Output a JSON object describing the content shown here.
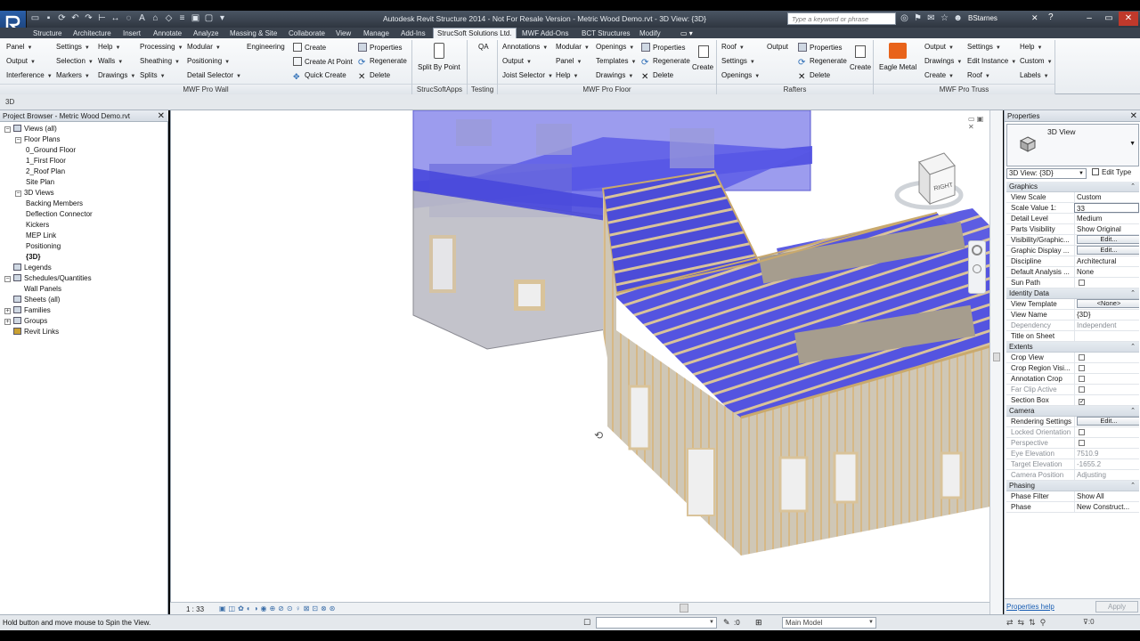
{
  "window": {
    "title": "Autodesk Revit Structure 2014 - Not For Resale Version -    Metric Wood Demo.rvt - 3D View: {3D}",
    "search_placeholder": "Type a keyword or phrase",
    "user": "BStarnes"
  },
  "tabs": [
    "Structure",
    "Architecture",
    "Insert",
    "Annotate",
    "Analyze",
    "Massing & Site",
    "Collaborate",
    "View",
    "Manage",
    "Add-Ins",
    "StrucSoft Solutions Ltd.",
    "MWF Add-Ons",
    "BCT Structures",
    "Modify"
  ],
  "active_tab": "StrucSoft Solutions Ltd.",
  "ribbon": {
    "wall": {
      "col1": [
        "Panel",
        "Output",
        "Interference"
      ],
      "col2": [
        "Settings",
        "Selection",
        "Markers"
      ],
      "col3": [
        "Help",
        "Walls",
        "Drawings"
      ],
      "col4": [
        "Processing",
        "Sheathing",
        "Splits"
      ],
      "col5": [
        "Modular",
        "Positioning",
        "Detail Selector"
      ],
      "engineering": "Engineering",
      "col6": [
        "Create",
        "Create At Point",
        "Quick Create"
      ],
      "col7": [
        "Properties",
        "Regenerate",
        "Delete"
      ],
      "label": "MWF Pro Wall"
    },
    "strucsoftapps": {
      "split": "Split By Point",
      "label": "StrucSoftApps"
    },
    "testing": {
      "qa": "QA",
      "label": "Testing"
    },
    "floor": {
      "col1": [
        "Annotations",
        "Output",
        "Joist Selector"
      ],
      "col2": [
        "Modular",
        "Panel",
        "Help"
      ],
      "col3": [
        "Openings",
        "Templates",
        "Drawings"
      ],
      "col4": [
        "Properties",
        "Regenerate",
        "Delete"
      ],
      "create": "Create",
      "label": "MWF Pro Floor"
    },
    "rafters": {
      "col1": [
        "Roof",
        "Settings",
        "Openings"
      ],
      "output": "Output",
      "col2": [
        "Properties",
        "Regenerate",
        "Delete"
      ],
      "create": "Create",
      "label": "Rafters"
    },
    "truss": {
      "eagle": "Eagle Metal",
      "col1": [
        "Output",
        "Drawings",
        "Create"
      ],
      "col2": [
        "Settings",
        "Edit Instance",
        "Roof"
      ],
      "col3": [
        "Help",
        "Custom",
        "Labels"
      ],
      "label": "MWF Pro Truss"
    }
  },
  "options_bar": {
    "text": "3D"
  },
  "project_browser": {
    "title": "Project Browser - Metric Wood Demo.rvt",
    "items": [
      {
        "label": "Views (all)",
        "level": 0,
        "toggle": "-"
      },
      {
        "label": "Floor Plans",
        "level": 1,
        "toggle": "-"
      },
      {
        "label": "0_Ground Floor",
        "level": 2,
        "toggle": ""
      },
      {
        "label": "1_First Floor",
        "level": 2,
        "toggle": ""
      },
      {
        "label": "2_Roof Plan",
        "level": 2,
        "toggle": ""
      },
      {
        "label": "Site Plan",
        "level": 2,
        "toggle": ""
      },
      {
        "label": "3D Views",
        "level": 1,
        "toggle": "-"
      },
      {
        "label": "Backing Members",
        "level": 2,
        "toggle": ""
      },
      {
        "label": "Deflection Connector",
        "level": 2,
        "toggle": ""
      },
      {
        "label": "Kickers",
        "level": 2,
        "toggle": ""
      },
      {
        "label": "MEP Link",
        "level": 2,
        "toggle": ""
      },
      {
        "label": "Positioning",
        "level": 2,
        "toggle": ""
      },
      {
        "label": "{3D}",
        "level": 2,
        "toggle": "",
        "bold": true
      },
      {
        "label": "Legends",
        "level": 0,
        "toggle": ""
      },
      {
        "label": "Schedules/Quantities",
        "level": 0,
        "toggle": "-"
      },
      {
        "label": "Wall Panels",
        "level": 1,
        "toggle": ""
      },
      {
        "label": "Sheets (all)",
        "level": 0,
        "toggle": ""
      },
      {
        "label": "Families",
        "level": 0,
        "toggle": "+"
      },
      {
        "label": "Groups",
        "level": 0,
        "toggle": "+"
      },
      {
        "label": "Revit Links",
        "level": 0,
        "toggle": ""
      }
    ]
  },
  "viewport": {
    "scale": "1 : 33",
    "viewcube_label": "RIGHT",
    "colors": {
      "glass": "#5a5ae6",
      "timber": "#d9c39a",
      "wall": "#c9c9c9"
    }
  },
  "properties": {
    "title": "Properties",
    "type_name": "3D View",
    "instance_selector": "3D View: {3D}",
    "edit_type": "Edit Type",
    "groups": [
      {
        "name": "Graphics",
        "rows": [
          {
            "k": "View Scale",
            "v": "Custom"
          },
          {
            "k": "Scale Value    1:",
            "v": "33",
            "box": true
          },
          {
            "k": "Detail Level",
            "v": "Medium"
          },
          {
            "k": "Parts Visibility",
            "v": "Show Original"
          },
          {
            "k": "Visibility/Graphic...",
            "v": "Edit...",
            "btn": true
          },
          {
            "k": "Graphic Display ...",
            "v": "Edit...",
            "btn": true
          },
          {
            "k": "Discipline",
            "v": "Architectural"
          },
          {
            "k": "Default Analysis ...",
            "v": "None"
          },
          {
            "k": "Sun Path",
            "v": "",
            "chk": ""
          }
        ]
      },
      {
        "name": "Identity Data",
        "rows": [
          {
            "k": "View Template",
            "v": "<None>",
            "btn": true
          },
          {
            "k": "View Name",
            "v": "{3D}"
          },
          {
            "k": "Dependency",
            "v": "Independent",
            "dim": true
          },
          {
            "k": "Title on Sheet",
            "v": ""
          }
        ]
      },
      {
        "name": "Extents",
        "rows": [
          {
            "k": "Crop View",
            "v": "",
            "chk": ""
          },
          {
            "k": "Crop Region Visi...",
            "v": "",
            "chk": ""
          },
          {
            "k": "Annotation Crop",
            "v": "",
            "chk": ""
          },
          {
            "k": "Far Clip Active",
            "v": "",
            "chk": "",
            "dim": true
          },
          {
            "k": "Section Box",
            "v": "",
            "chk": "✓"
          }
        ]
      },
      {
        "name": "Camera",
        "rows": [
          {
            "k": "Rendering Settings",
            "v": "Edit...",
            "btn": true
          },
          {
            "k": "Locked Orientation",
            "v": "",
            "chk": "",
            "dim": true
          },
          {
            "k": "Perspective",
            "v": "",
            "chk": "",
            "dim": true
          },
          {
            "k": "Eye Elevation",
            "v": "7510.9",
            "dim": true
          },
          {
            "k": "Target Elevation",
            "v": "-1655.2",
            "dim": true
          },
          {
            "k": "Camera Position",
            "v": "Adjusting",
            "dim": true
          }
        ]
      },
      {
        "name": "Phasing",
        "rows": [
          {
            "k": "Phase Filter",
            "v": "Show All"
          },
          {
            "k": "Phase",
            "v": "New Construct..."
          }
        ]
      }
    ],
    "help_link": "Properties help",
    "apply": "Apply"
  },
  "status": {
    "text": "Hold button and move mouse to Spin the View.",
    "filter_count": ":0",
    "model": "Main Model"
  }
}
